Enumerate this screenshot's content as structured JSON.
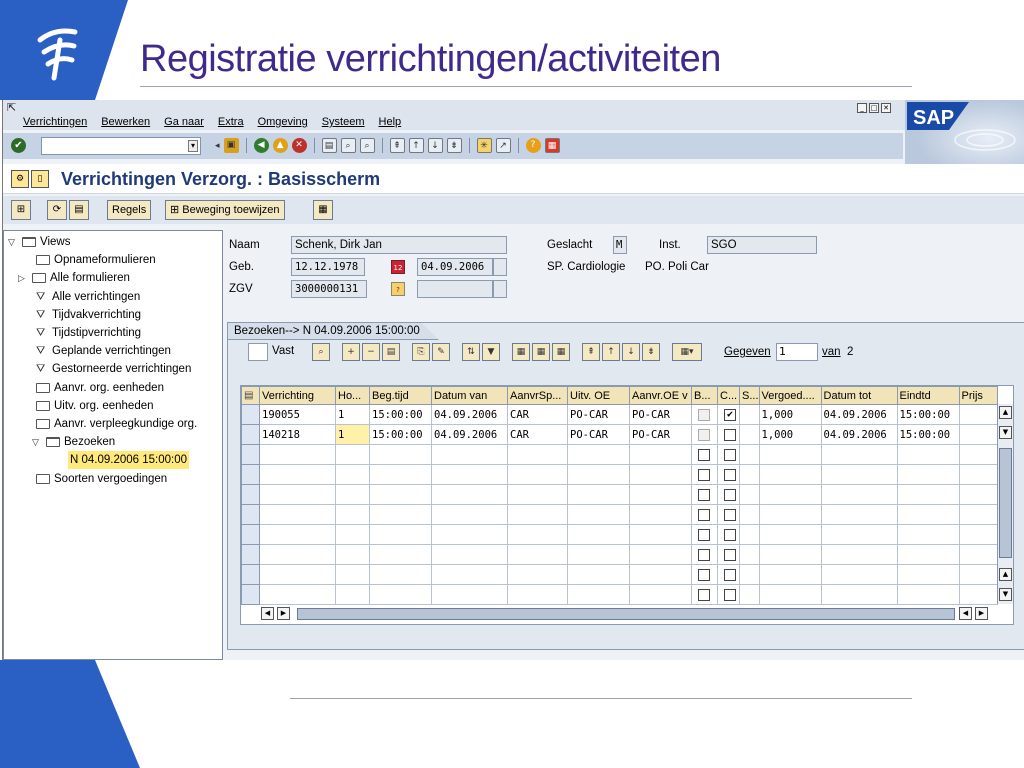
{
  "slide": {
    "title": "Registratie verrichtingen/activiteiten"
  },
  "menu": {
    "items": [
      "Verrichtingen",
      "Bewerken",
      "Ga naar",
      "Extra",
      "Omgeving",
      "Systeem",
      "Help"
    ]
  },
  "sap_logo": "SAP",
  "command_field": {
    "value": ""
  },
  "screen": {
    "title": "Verrichtingen Verzorg. : Basisscherm"
  },
  "app_toolbar": {
    "regels_label": "Regels",
    "beweging_label": "Beweging toewijzen"
  },
  "tree": {
    "items": [
      {
        "label": "Views",
        "level": 0,
        "expanded": true,
        "icon": "folder-open-icon"
      },
      {
        "label": "Opnameformulieren",
        "level": 1,
        "icon": "folder-icon"
      },
      {
        "label": "Alle formulieren",
        "level": 1,
        "icon": "folder-icon",
        "collapsed": true
      },
      {
        "label": "Alle verrichtingen",
        "level": 1,
        "icon": "funnel-icon"
      },
      {
        "label": "Tijdvakverrichting",
        "level": 1,
        "icon": "funnel-icon"
      },
      {
        "label": "Tijdstipverrichting",
        "level": 1,
        "icon": "funnel-icon"
      },
      {
        "label": "Geplande verrichtingen",
        "level": 1,
        "icon": "funnel-icon"
      },
      {
        "label": "Gestorneerde verrichtingen",
        "level": 1,
        "icon": "funnel-icon"
      },
      {
        "label": "Aanvr. org. eenheden",
        "level": 1,
        "icon": "folder-icon"
      },
      {
        "label": "Uitv. org. eenheden",
        "level": 1,
        "icon": "folder-icon"
      },
      {
        "label": "Aanvr. verpleegkundige org.",
        "level": 1,
        "icon": "folder-icon"
      },
      {
        "label": "Bezoeken",
        "level": 1,
        "expanded": true,
        "icon": "folder-open-icon"
      },
      {
        "label": "N  04.09.2006 15:00:00",
        "level": 2,
        "selected": true
      },
      {
        "label": "Soorten vergoedingen",
        "level": 1,
        "icon": "folder-icon"
      }
    ]
  },
  "patient": {
    "naam_label": "Naam",
    "naam_value": "Schenk, Dirk Jan",
    "geb_label": "Geb.",
    "geb_value": "12.12.1978",
    "date_value": "04.09.2006",
    "zgv_label": "ZGV",
    "zgv_value": "3000000131",
    "geslacht_label": "Geslacht",
    "geslacht_value": "M",
    "inst_label": "Inst.",
    "inst_value": "SGO",
    "sp_text": "SP. Cardiologie",
    "po_text": "PO. Poli Car"
  },
  "tab": {
    "label": "Bezoeken--> N  04.09.2006 15:00:00",
    "vast_label": "Vast",
    "gegeven_label": "Gegeven",
    "gegeven_value": "1",
    "van_label": "van",
    "van_value": "2"
  },
  "grid": {
    "columns": [
      "Verrichting",
      "Ho...",
      "Beg.tijd",
      "Datum van",
      "AanvrSp...",
      "Uitv. OE",
      "Aanvr.OE v",
      "B...",
      "C...",
      "S...",
      "Vergoed....",
      "Datum tot",
      "Eindtd",
      "Prijs"
    ],
    "rows": [
      {
        "verrichting": "190055",
        "ho": "1",
        "begtijd": "15:00:00",
        "datumvan": "04.09.2006",
        "aanvrsp": "CAR",
        "uitvoe": "PO-CAR",
        "aanvroe": "PO-CAR",
        "b": false,
        "c": true,
        "vergoed": "1,000",
        "datumtot": "04.09.2006",
        "eindtd": "15:00:00",
        "prijs": ""
      },
      {
        "verrichting": "140218",
        "ho": "1",
        "begtijd": "15:00:00",
        "datumvan": "04.09.2006",
        "aanvrsp": "CAR",
        "uitvoe": "PO-CAR",
        "aanvroe": "PO-CAR",
        "b": false,
        "c": false,
        "vergoed": "1,000",
        "datumtot": "04.09.2006",
        "eindtd": "15:00:00",
        "prijs": ""
      }
    ],
    "empty_rows": 8
  },
  "colors": {
    "title": "#3d2a8c",
    "sap_blue": "#1f3a7a",
    "brand_blue": "#2a5fc4",
    "header_bg": "#f0e4b8",
    "selected": "#ffe97a"
  }
}
